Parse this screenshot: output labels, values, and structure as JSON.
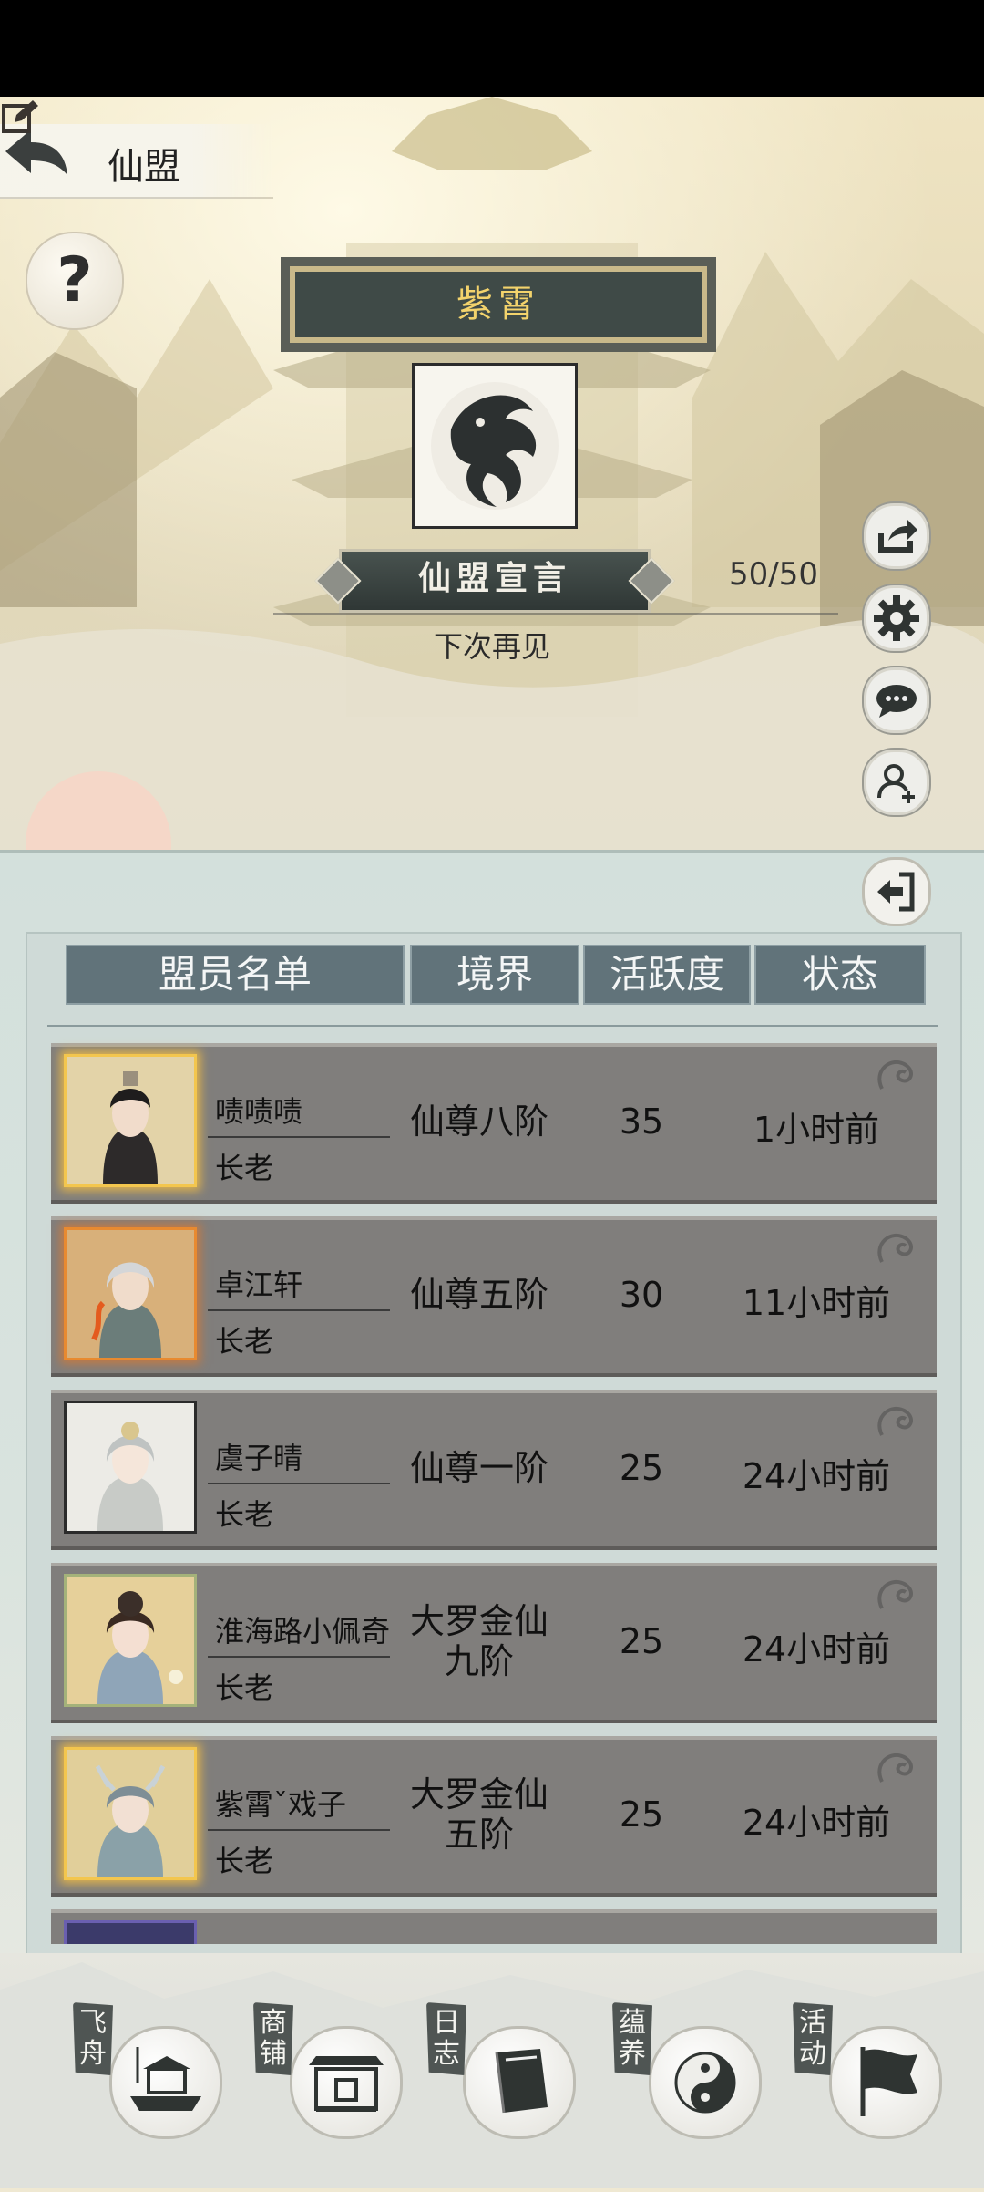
{
  "header": {
    "title": "仙盟",
    "back_icon": "back-arrow-icon",
    "help_label": "?"
  },
  "sect": {
    "name": "紫霄",
    "emblem_icon": "dragon-emblem-icon",
    "declaration_title": "仙盟宣言",
    "member_count": "50/50",
    "declaration_text": "下次再见"
  },
  "side_buttons": [
    {
      "name": "share-icon"
    },
    {
      "name": "gear-icon"
    },
    {
      "name": "chat-icon"
    },
    {
      "name": "add-member-icon"
    }
  ],
  "table": {
    "headers": [
      "盟员名单",
      "境界",
      "活跃度",
      "状态"
    ],
    "rows": [
      {
        "name": "啧啧啧",
        "role": "长老",
        "realm": "仙尊八阶",
        "activity": "35",
        "status": "1小时前",
        "frame": "gold"
      },
      {
        "name": "卓江轩",
        "role": "长老",
        "realm": "仙尊五阶",
        "activity": "30",
        "status": "11小时前",
        "frame": "orange"
      },
      {
        "name": "虞子晴",
        "role": "长老",
        "realm": "仙尊一阶",
        "activity": "25",
        "status": "24小时前",
        "frame": "plain"
      },
      {
        "name": "淮海路小佩奇",
        "role": "长老",
        "realm": "大罗金仙\n九阶",
        "activity": "25",
        "status": "24小时前",
        "frame": "greenleaf"
      },
      {
        "name": "紫霄ˇ戏子",
        "role": "长老",
        "realm": "大罗金仙\n五阶",
        "activity": "25",
        "status": "24小时前",
        "frame": "gold"
      }
    ]
  },
  "bottom_nav": [
    {
      "label": "飞舟",
      "icon": "boat-icon"
    },
    {
      "label": "商铺",
      "icon": "shop-icon"
    },
    {
      "label": "日志",
      "icon": "book-icon"
    },
    {
      "label": "蕴养",
      "icon": "yinyang-icon"
    },
    {
      "label": "活动",
      "icon": "flag-icon"
    }
  ],
  "colors": {
    "sect_name": "#f3d36c",
    "row_bg": "#807e7c",
    "header_bg": "#61737a"
  }
}
